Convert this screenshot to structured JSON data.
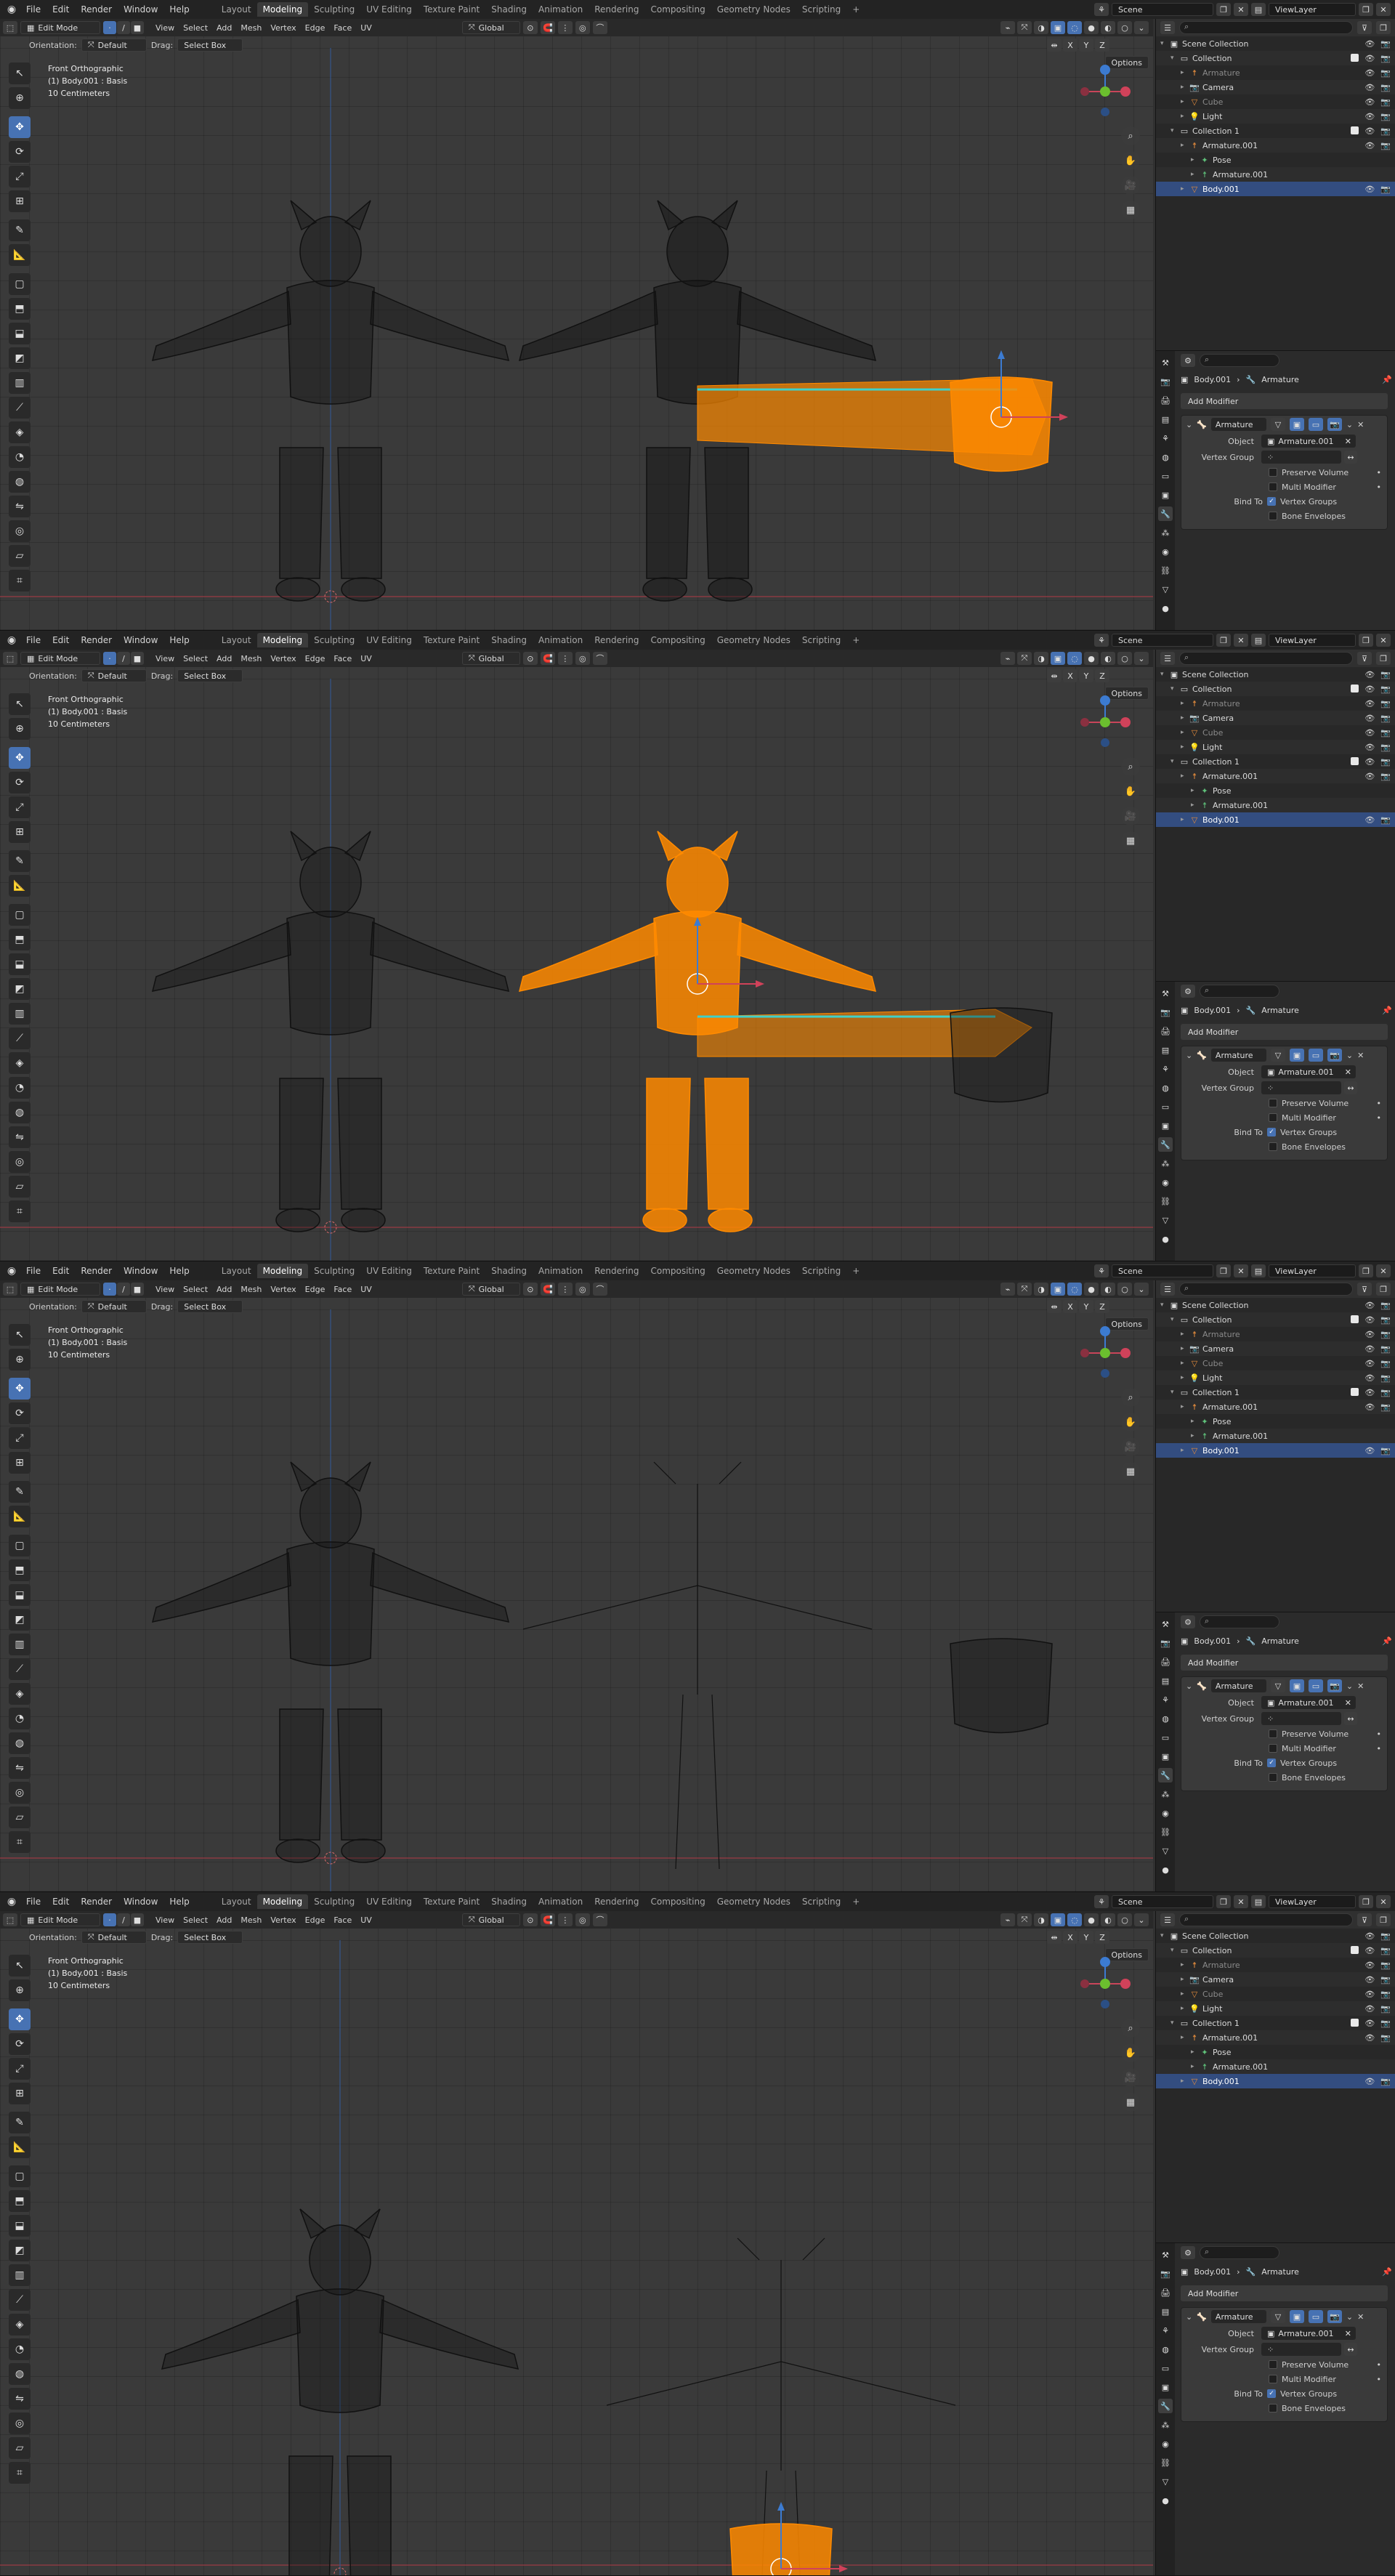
{
  "topbar": {
    "menus": [
      "File",
      "Edit",
      "Render",
      "Window",
      "Help"
    ],
    "workspaces": [
      "Layout",
      "Modeling",
      "Sculpting",
      "UV Editing",
      "Texture Paint",
      "Shading",
      "Animation",
      "Rendering",
      "Compositing",
      "Geometry Nodes",
      "Scripting"
    ],
    "active_workspace": "Modeling",
    "scene": "Scene",
    "view_layer": "ViewLayer"
  },
  "viewport": {
    "mode": "Edit Mode",
    "menus": [
      "View",
      "Select",
      "Add",
      "Mesh",
      "Vertex",
      "Edge",
      "Face",
      "UV"
    ],
    "transform": "Global",
    "orientation_label": "Orientation:",
    "orientation_value": "Default",
    "drag_label": "Drag:",
    "drag_value": "Select Box",
    "options": "Options",
    "axes": [
      "X",
      "Y",
      "Z"
    ],
    "info": [
      "Front Orthographic",
      "(1) Body.001 : Basis",
      "10 Centimeters"
    ]
  },
  "outliner": {
    "search_placeholder": "",
    "rows": [
      {
        "label": "Scene Collection",
        "icon": "scene-collection-icon",
        "indent": 0,
        "dim": false
      },
      {
        "label": "Collection",
        "icon": "collection-icon",
        "indent": 1,
        "dim": false
      },
      {
        "label": "Armature",
        "icon": "armature-icon",
        "indent": 2,
        "dim": true
      },
      {
        "label": "Camera",
        "icon": "camera-icon",
        "indent": 2,
        "dim": false
      },
      {
        "label": "Cube",
        "icon": "mesh-icon",
        "indent": 2,
        "dim": true
      },
      {
        "label": "Light",
        "icon": "light-icon",
        "indent": 2,
        "dim": false
      },
      {
        "label": "Collection 1",
        "icon": "collection-icon",
        "indent": 1,
        "dim": false
      },
      {
        "label": "Armature.001",
        "icon": "armature-icon",
        "indent": 2,
        "dim": false
      },
      {
        "label": "Pose",
        "icon": "pose-icon",
        "indent": 3,
        "dim": false
      },
      {
        "label": "Armature.001",
        "icon": "armature-data-icon",
        "indent": 3,
        "dim": false
      },
      {
        "label": "Body.001",
        "icon": "mesh-icon",
        "indent": 2,
        "dim": false,
        "selected": true
      }
    ]
  },
  "properties": {
    "object_name": "Body.001",
    "modifier_crumb": "Armature",
    "add_modifier": "Add Modifier",
    "modifier_name": "Armature",
    "object_label": "Object",
    "object_value": "Armature.001",
    "vertex_group_label": "Vertex Group",
    "preserve_volume": "Preserve Volume",
    "multi_modifier": "Multi Modifier",
    "bind_to_label": "Bind To",
    "vertex_groups": "Vertex Groups",
    "bone_envelopes": "Bone Envelopes"
  },
  "colors": {
    "accent": "#4772b3",
    "selection_orange": "#ff8a00",
    "viewport_bg": "#3a3a3a"
  },
  "frames": [
    {
      "state": "mesh-part-offset-edit"
    },
    {
      "state": "body-selected"
    },
    {
      "state": "armature-with-separated-part"
    },
    {
      "state": "part-attached"
    }
  ]
}
